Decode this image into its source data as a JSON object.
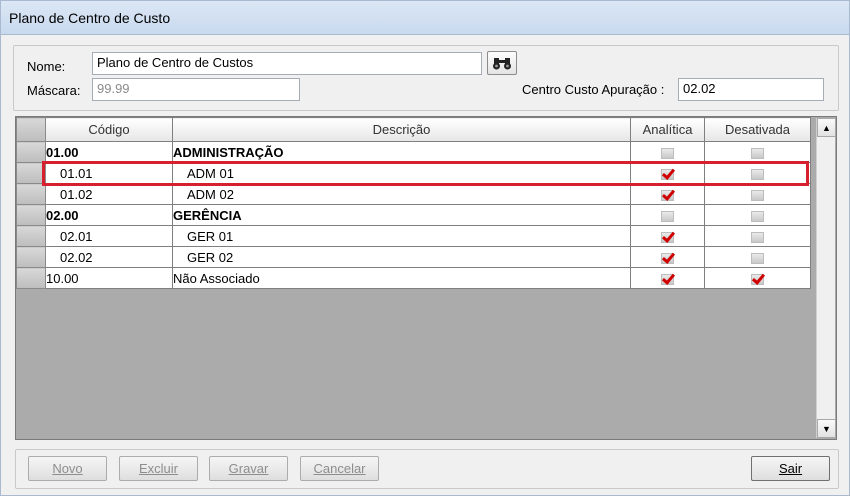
{
  "window": {
    "title": "Plano de Centro de Custo"
  },
  "form": {
    "nome_label": "Nome:",
    "nome_value": "Plano de Centro de Custos",
    "mascara_label": "Máscara:",
    "mascara_value": "99.99",
    "apuracao_label": "Centro Custo Apuração :",
    "apuracao_value": "02.02",
    "search_icon": "binoculars-icon"
  },
  "grid": {
    "columns": [
      "Código",
      "Descrição",
      "Analítica",
      "Desativada"
    ],
    "rows": [
      {
        "codigo": "01.00",
        "descricao": "ADMINISTRAÇÃO",
        "analitica": false,
        "desativada": false,
        "bold": true,
        "child": false
      },
      {
        "codigo": "01.01",
        "descricao": "ADM 01",
        "analitica": true,
        "desativada": false,
        "bold": false,
        "child": true,
        "highlighted": true
      },
      {
        "codigo": "01.02",
        "descricao": "ADM 02",
        "analitica": true,
        "desativada": false,
        "bold": false,
        "child": true
      },
      {
        "codigo": "02.00",
        "descricao": "GERÊNCIA",
        "analitica": false,
        "desativada": false,
        "bold": true,
        "child": false
      },
      {
        "codigo": "02.01",
        "descricao": "GER 01",
        "analitica": true,
        "desativada": false,
        "bold": false,
        "child": true
      },
      {
        "codigo": "02.02",
        "descricao": "GER 02",
        "analitica": true,
        "desativada": false,
        "bold": false,
        "child": true
      },
      {
        "codigo": "10.00",
        "descricao": "Não Associado",
        "analitica": true,
        "desativada": true,
        "bold": false,
        "child": false
      }
    ],
    "highlight_color": "#d62030",
    "check_color": "#d00000"
  },
  "buttons": {
    "novo": "Novo",
    "excluir": "Excluir",
    "gravar": "Gravar",
    "cancelar": "Cancelar",
    "sair": "Sair"
  }
}
